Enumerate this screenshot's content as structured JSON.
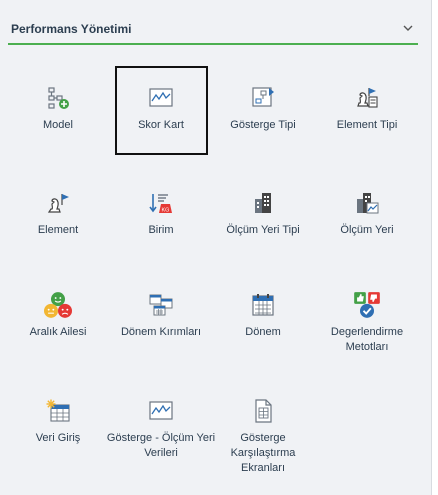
{
  "section": {
    "title": "Performans Yönetimi",
    "chevron": "chevron-down-icon"
  },
  "tiles": [
    {
      "label": "Model",
      "icon": "model-add-icon"
    },
    {
      "label": "Skor Kart",
      "icon": "line-chart-icon",
      "selected": true
    },
    {
      "label": "Gösterge Tipi",
      "icon": "indicator-type-icon"
    },
    {
      "label": "Element Tipi",
      "icon": "element-type-icon"
    },
    {
      "label": "Element",
      "icon": "element-flag-icon"
    },
    {
      "label": "Birim",
      "icon": "unit-kg-icon"
    },
    {
      "label": "Ölçüm Yeri Tipi",
      "icon": "building-icon"
    },
    {
      "label": "Ölçüm Yeri",
      "icon": "building-chart-icon"
    },
    {
      "label": "Aralık Ailesi",
      "icon": "smiley-faces-icon"
    },
    {
      "label": "Dönem Kırımları",
      "icon": "calendar-grid-icon"
    },
    {
      "label": "Dönem",
      "icon": "calendar-icon"
    },
    {
      "label": "Degerlendirme Metotları",
      "icon": "thumbs-check-icon"
    },
    {
      "label": "Veri Giriş",
      "icon": "data-entry-table-icon"
    },
    {
      "label": "Gösterge - Ölçüm Yeri Verileri",
      "icon": "line-chart-icon"
    },
    {
      "label": "Gösterge Karşılaştırma Ekranları",
      "icon": "document-compare-icon"
    }
  ],
  "colors": {
    "accent": "#4caf50",
    "icon_gray": "#6b7580",
    "icon_blue": "#2f6fb3",
    "icon_green": "#43a047",
    "icon_red": "#e53935"
  }
}
